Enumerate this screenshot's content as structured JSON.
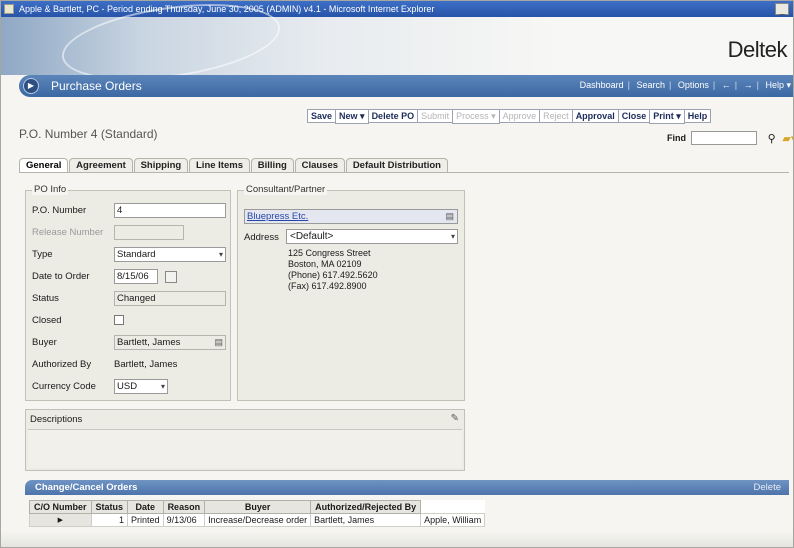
{
  "window": {
    "title": "Apple & Bartlett, PC - Period ending Thursday, June 30, 2005 (ADMIN) v4.1 - Microsoft Internet Explorer",
    "control": "_"
  },
  "brand": "Deltek",
  "module": {
    "title": "Purchase Orders",
    "links": [
      "Dashboard",
      "Search",
      "Options",
      "←",
      "→",
      "Help ▾"
    ]
  },
  "toolbar": {
    "items": [
      {
        "label": "Save",
        "enabled": true
      },
      {
        "label": "New ▾",
        "enabled": true
      },
      {
        "label": "Delete PO",
        "enabled": true
      },
      {
        "label": "Submit",
        "enabled": false
      },
      {
        "label": "Process ▾",
        "enabled": false
      },
      {
        "label": "Approve",
        "enabled": false
      },
      {
        "label": "Reject",
        "enabled": false
      },
      {
        "label": "Approval",
        "enabled": true
      },
      {
        "label": "Close",
        "enabled": true
      },
      {
        "label": "Print ▾",
        "enabled": true
      },
      {
        "label": "Help",
        "enabled": true
      }
    ]
  },
  "page_title": "P.O. Number 4 (Standard)",
  "find": {
    "label": "Find",
    "value": ""
  },
  "tabs": [
    "General",
    "Agreement",
    "Shipping",
    "Line Items",
    "Billing",
    "Clauses",
    "Default Distribution"
  ],
  "active_tab": "General",
  "po_info": {
    "legend": "PO Info",
    "po_number_label": "P.O. Number",
    "po_number": "4",
    "release_number_label": "Release Number",
    "release_number": "",
    "type_label": "Type",
    "type": "Standard",
    "date_label": "Date to Order",
    "date": "8/15/06",
    "status_label": "Status",
    "status": "Changed",
    "closed_label": "Closed",
    "buyer_label": "Buyer",
    "buyer": "Bartlett, James",
    "authorized_label": "Authorized By",
    "authorized": "Bartlett, James",
    "currency_label": "Currency Code",
    "currency": "USD"
  },
  "consultant": {
    "legend": "Consultant/Partner",
    "name": "Bluepress Etc.",
    "address_label": "Address",
    "address_selected": "<Default>",
    "address_lines": [
      "125 Congress Street",
      "Boston, MA 02109",
      "(Phone) 617.492.5620",
      "(Fax) 617.492.8900"
    ]
  },
  "descriptions": {
    "label": "Descriptions"
  },
  "change_cancel": {
    "title": "Change/Cancel Orders",
    "delete_label": "Delete",
    "columns": [
      "C/O Number",
      "Status",
      "Date",
      "Reason",
      "Buyer",
      "Authorized/Rejected By"
    ],
    "rows": [
      {
        "marker": "▶",
        "number": "1",
        "status": "Printed",
        "date": "9/13/06",
        "reason": "Increase/Decrease order",
        "buyer": "Bartlett, James",
        "authorized": "Apple, William"
      }
    ]
  }
}
